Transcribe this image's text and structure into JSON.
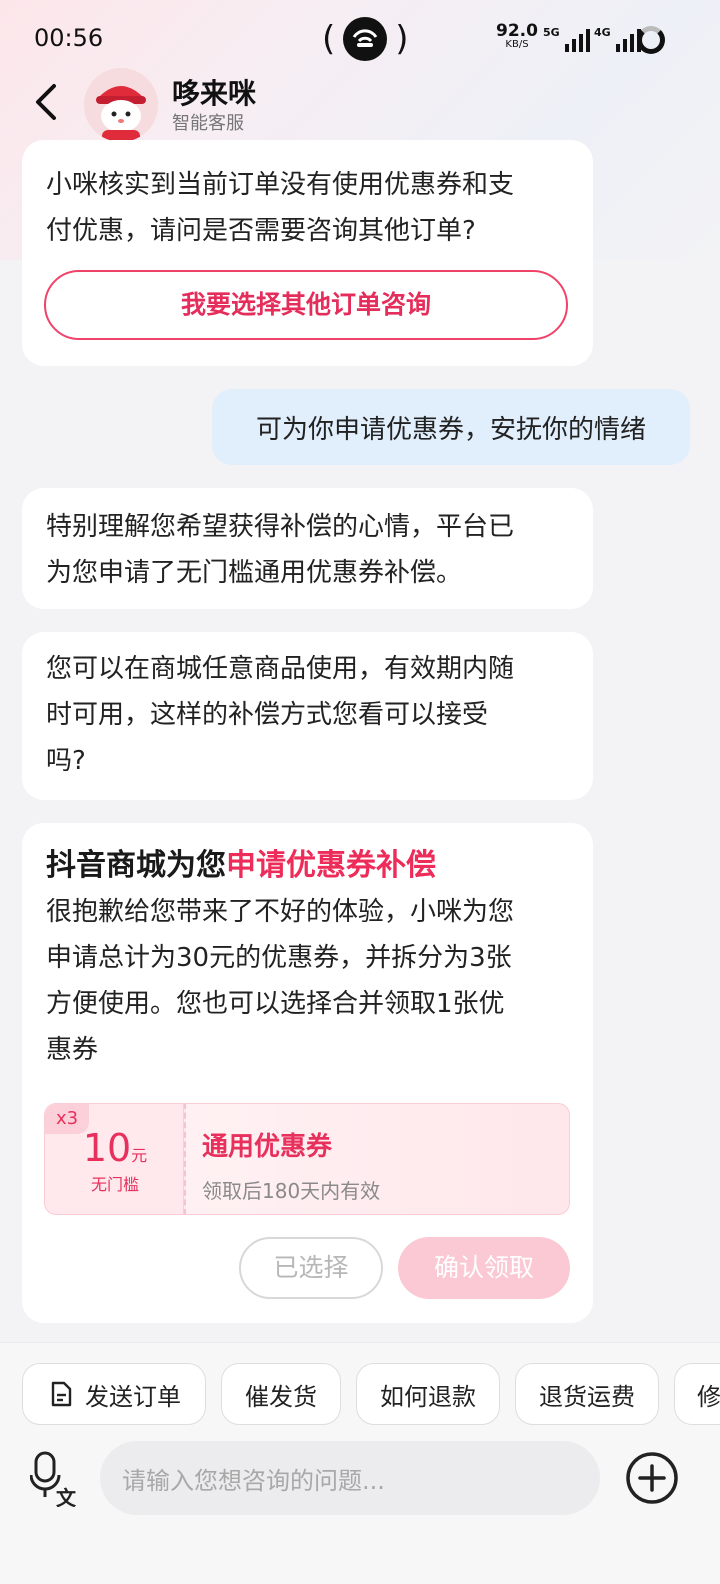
{
  "status_bar": {
    "time": "00:56",
    "net_speed": "92.0",
    "net_unit": "KB/S",
    "sim1": "5G",
    "sim2": "4G"
  },
  "header": {
    "name": "哆来咪",
    "subtitle": "智能客服"
  },
  "messages": {
    "m1_line1": "小咪核实到当前订单没有使用优惠券和支",
    "m1_line2": "付优惠，请问是否需要咨询其他订单?",
    "m1_button": "我要选择其他订单咨询",
    "user_msg": "可为你申请优惠券，安抚你的情绪",
    "m2_line1": "特别理解您希望获得补偿的心情，平台已",
    "m2_line2": "为您申请了无门槛通用优惠券补偿。",
    "m3_line1": "您可以在商城任意商品使用，有效期内随",
    "m3_line2": "时可用，这样的补偿方式您看可以接受",
    "m3_line3": "吗?"
  },
  "coupon_card": {
    "title_prefix": "抖音商城为您",
    "title_highlight": "申请优惠券补偿",
    "body_line1": "很抱歉给您带来了不好的体验，小咪为您",
    "body_line2": "申请总计为30元的优惠券，并拆分为3张",
    "body_line3": "方便使用。您也可以选择合并领取1张优",
    "body_line4": "惠券",
    "coupon": {
      "multiplier": "x3",
      "amount": "10",
      "unit": "元",
      "condition": "无门槛",
      "name": "通用优惠券",
      "validity": "领取后180天内有效"
    },
    "selected_label": "已选择",
    "confirm_label": "确认领取"
  },
  "quick_actions": [
    "发送订单",
    "催发货",
    "如何退款",
    "退货运费",
    "修"
  ],
  "input": {
    "placeholder": "请输入您想咨询的问题..."
  },
  "colors": {
    "accent": "#ee2c5a",
    "user_bubble": "#e1eefc"
  }
}
